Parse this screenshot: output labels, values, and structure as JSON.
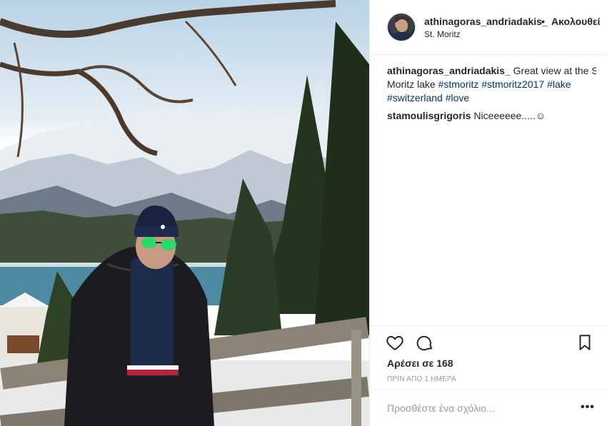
{
  "post": {
    "username": "athinagoras_andriadakis_",
    "separator": "•",
    "follow_label": "Ακολουθεί",
    "location": "St. Moritz",
    "caption": {
      "username": "athinagoras_andriadakis_",
      "text_line1": "Great view at the St",
      "text_line2_prefix": "Moritz lake",
      "hashtags": [
        "#stmoritz",
        "#stmoritz2017",
        "#lake",
        "#switzerland",
        "#love"
      ]
    },
    "comments": [
      {
        "username": "stamoulisgrigoris",
        "text": "Niceeeeee.....☺"
      }
    ],
    "likes_text": "Αρέσει σε 168",
    "time_text": "ΠΡΙΝ ΑΠΟ 1 ΗΜΕΡΑ",
    "comment_placeholder": "Προσθέστε ένα σχόλιο...",
    "more_label": "•••"
  },
  "icons": {
    "like": "heart-icon",
    "comment": "comment-icon",
    "save": "bookmark-icon",
    "more": "more-options-icon"
  },
  "colors": {
    "text": "#262626",
    "hashtag": "#003569",
    "muted": "#999999",
    "border": "#efefef"
  }
}
